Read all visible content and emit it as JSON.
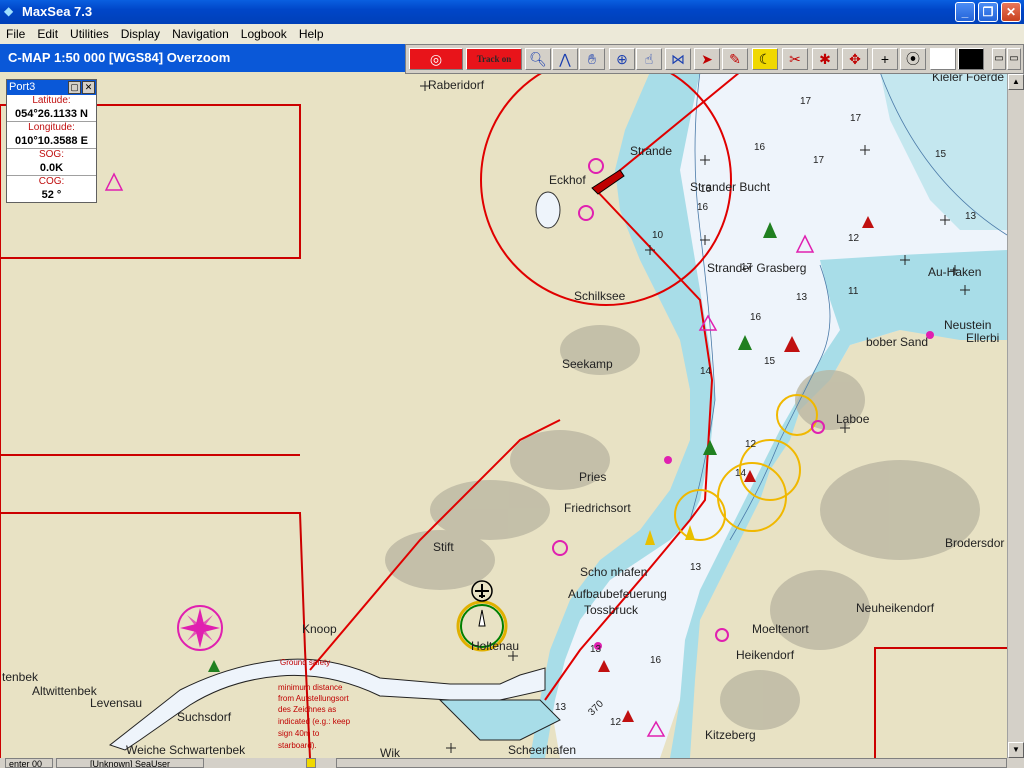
{
  "window": {
    "title": "MaxSea 7.3",
    "minimize": "_",
    "maximize": "❐",
    "close": "✕"
  },
  "menu": [
    "File",
    "Edit",
    "Utilities",
    "Display",
    "Navigation",
    "Logbook",
    "Help"
  ],
  "chart_header": {
    "label": "C-MAP  1:50 000 [WGS84]    Overzoom"
  },
  "toolbar": {
    "track_label": "Track on"
  },
  "port": {
    "title": "Port3",
    "latitude_label": "Latitude:",
    "latitude": "054°26.1133 N",
    "longitude_label": "Longitude:",
    "longitude": "010°10.3588 E",
    "sog_label": "SOG:",
    "sog": "0.0K",
    "cog_label": "COG:",
    "cog": "52 °"
  },
  "map": {
    "places": {
      "raberidorf": "Raberidorf",
      "eckhof": "Eckhof",
      "strande": "Strande",
      "strander_bucht": "Strander Bucht",
      "strander_grasberg": "Strander Grasberg",
      "schilksee": "Schilksee",
      "seekamp": "Seekamp",
      "pries": "Pries",
      "friedrichsort": "Friedrichsort",
      "stift": "Stift",
      "laboe": "Laboe",
      "au_haken": "Au-Haken",
      "neustein": "Neustein",
      "ellerbek": "Ellerbi",
      "bober_sand": "bober Sand",
      "brodersdorf": "Brodersdor",
      "neuheikendorf": "Neuheikendorf",
      "moeltenort": "Moeltenort",
      "heikendorf": "Heikendorf",
      "schoenhafen": "Scho nhafen",
      "aufbau": "Aufbaubefeuerung",
      "holtenau": "Holtenau",
      "knoop": "Knoop",
      "tenbek": "tenbek",
      "altwittenbek": "Altwittenbek",
      "levensau": "Levensau",
      "suchsdorf": "Suchsdorf",
      "weiche": "Weiche Schwartenbek",
      "scheerhafen": "Scheerhafen",
      "kitzeberg": "Kitzeberg",
      "wik": "Wik",
      "kieler_foerde": "Kieler Foerde",
      "tossbruck": "Tossbruck"
    },
    "annotation": [
      "Ground safety",
      "minimum distance",
      "from Aufstellungsort",
      "des Zeichnes as",
      "indicated (e.g.: keep",
      "sign 40m to",
      "starboard)."
    ],
    "depths": [
      "17",
      "17",
      "16",
      "17",
      "15",
      "16",
      "13",
      "12",
      "16",
      "15",
      "13",
      "14",
      "12",
      "10",
      "11",
      "17",
      "14",
      "13",
      "16",
      "13",
      "12",
      "370",
      "13",
      "16"
    ]
  },
  "status": {
    "cell1": "enter 00",
    "cell2": "[Unknown] SeaUser"
  },
  "colors": {
    "land": "#e8e2c4",
    "shallow": "#a8dde8",
    "water": "#eef4fb",
    "route": "#e00000",
    "titlebar": "#0a58d8"
  }
}
